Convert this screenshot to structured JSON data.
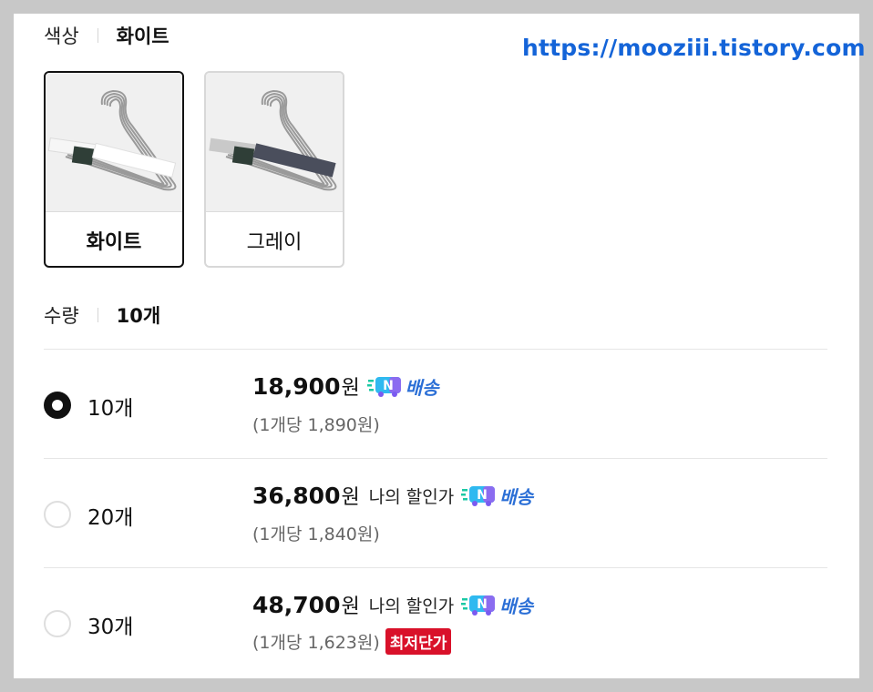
{
  "watermark": "https://mooziii.tistory.com",
  "color_option": {
    "label": "색상",
    "selected_value": "화이트",
    "swatches": [
      {
        "name": "화이트",
        "selected": true
      },
      {
        "name": "그레이",
        "selected": false
      }
    ]
  },
  "quantity_option": {
    "label": "수량",
    "selected_value": "10개",
    "options": [
      {
        "qty": "10개",
        "price": "18,900",
        "won": "원",
        "discount_label": "",
        "delivery": "배송",
        "unit_price": "(1개당 1,890원)",
        "badge": "",
        "selected": true
      },
      {
        "qty": "20개",
        "price": "36,800",
        "won": "원",
        "discount_label": "나의 할인가",
        "delivery": "배송",
        "unit_price": "(1개당 1,840원)",
        "badge": "",
        "selected": false
      },
      {
        "qty": "30개",
        "price": "48,700",
        "won": "원",
        "discount_label": "나의 할인가",
        "delivery": "배송",
        "unit_price": "(1개당 1,623원)",
        "badge": "최저단가",
        "selected": false
      }
    ]
  },
  "colors": {
    "accent": "#1464d8",
    "badge_red": "#d9112a",
    "delivery_blue": "#2b6fd6"
  },
  "icons": [
    "n-delivery-icon",
    "radio-selected-icon",
    "radio-unselected-icon"
  ]
}
